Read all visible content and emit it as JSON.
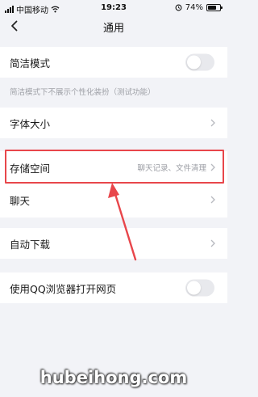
{
  "status_bar": {
    "carrier": "中国移动",
    "time": "19:23",
    "battery_pct": "74%",
    "battery_level": 0.74
  },
  "nav": {
    "title": "通用",
    "back_icon": "chevron-left-icon"
  },
  "settings": {
    "simple_mode": {
      "label": "简洁模式",
      "enabled": false
    },
    "simple_mode_note": "简洁模式下不展示个性化装扮（测试功能）",
    "font_size": {
      "label": "字体大小"
    },
    "storage": {
      "label": "存储空间",
      "detail": "聊天记录、文件清理"
    },
    "chat": {
      "label": "聊天"
    },
    "auto_download": {
      "label": "自动下载"
    },
    "qq_browser": {
      "label": "使用QQ浏览器打开网页",
      "enabled": false
    }
  },
  "annotation": {
    "color": "#e8464b"
  },
  "watermark": "hubeihong.com"
}
